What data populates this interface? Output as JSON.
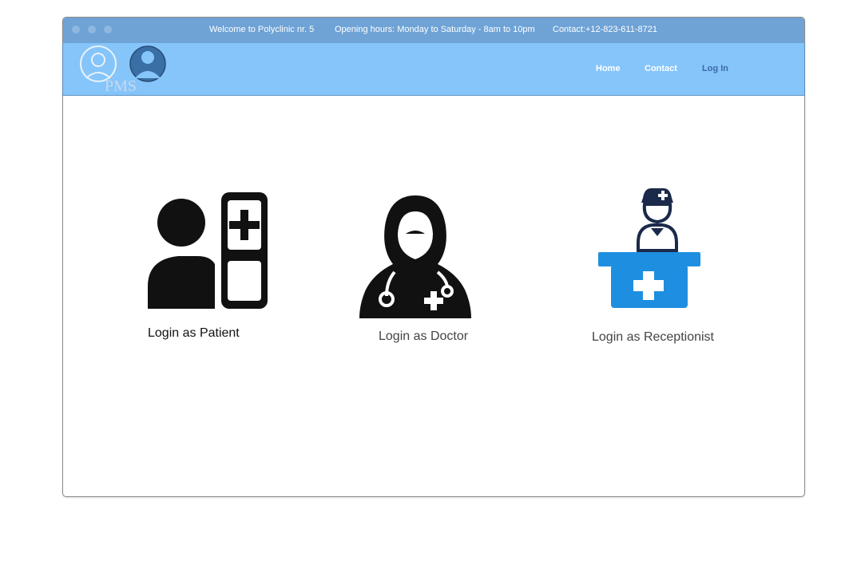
{
  "topbar": {
    "welcome": "Welcome to Polyclinic nr. 5",
    "hours": "Opening hours: Monday to Saturday - 8am to 10pm",
    "contact": "Contact:+12-823-611-8721"
  },
  "logo": {
    "text": "PMS"
  },
  "nav": {
    "home": "Home",
    "contact": "Contact",
    "login": "Log In"
  },
  "cards": {
    "patient": "Login as Patient",
    "doctor": "Login as Doctor",
    "receptionist": "Login as Receptionist"
  },
  "colors": {
    "topbar": "#6fa3d6",
    "navbar": "#85c5fa",
    "nav_active": "#3d68a8",
    "receptionist_desk": "#1e8fe0",
    "receptionist_figure": "#1b2a4a",
    "icon_dark": "#111111"
  }
}
